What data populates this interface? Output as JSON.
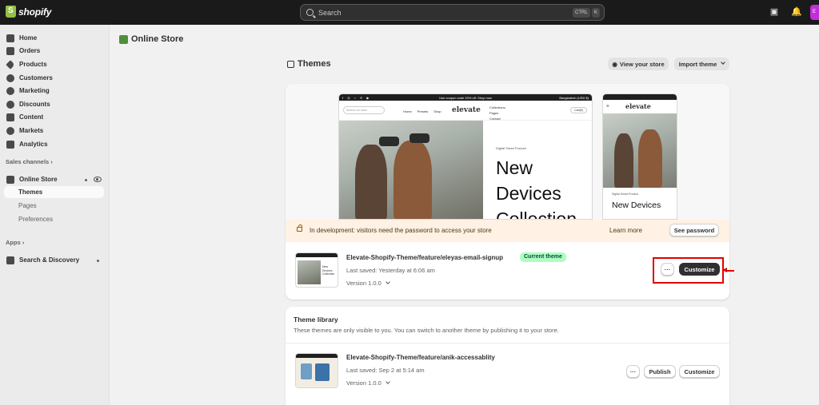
{
  "topbar": {
    "brand": "shopify",
    "search_placeholder": "Search",
    "shortcut_ctrl": "CTRL",
    "shortcut_key": "K",
    "avatar_initials": "E"
  },
  "sidebar": {
    "items": [
      {
        "label": "Home",
        "icon": "home-icon"
      },
      {
        "label": "Orders",
        "icon": "orders-icon"
      },
      {
        "label": "Products",
        "icon": "tag-icon"
      },
      {
        "label": "Customers",
        "icon": "person-icon"
      },
      {
        "label": "Marketing",
        "icon": "target-icon"
      },
      {
        "label": "Discounts",
        "icon": "discount-icon"
      },
      {
        "label": "Content",
        "icon": "content-icon"
      },
      {
        "label": "Markets",
        "icon": "globe-icon"
      },
      {
        "label": "Analytics",
        "icon": "bar-chart-icon"
      }
    ],
    "sales_channels_label": "Sales channels",
    "online_store_label": "Online Store",
    "sub_items": [
      "Themes",
      "Pages",
      "Preferences"
    ],
    "apps_label": "Apps",
    "search_discovery_label": "Search & Discovery"
  },
  "page": {
    "title": "Online Store",
    "themes_title": "Themes",
    "view_store_label": "View your store",
    "import_theme_label": "Import theme"
  },
  "preview": {
    "announcement": "Use coupon code 20% off. Shop now",
    "region": "Bangladesh (USD $)",
    "search_placeholder": "Search our store",
    "nav_links": [
      "Home",
      "Presets",
      "Shop"
    ],
    "logo": "elevate",
    "nav_links_right": [
      "Collections",
      "Pages",
      "Contact"
    ],
    "cart_label": "Cart(0)",
    "eyebrow": "Digital Smart Product",
    "headline_lines": [
      "New",
      "Devices",
      "Collection"
    ],
    "mobile_headline": "New Devices"
  },
  "banner": {
    "text": "In development: visitors need the password to access your store",
    "learn_more": "Learn more",
    "see_password": "See password"
  },
  "current_theme": {
    "name": "Elevate-Shopify-Theme/feature/eleyas-email-signup",
    "badge": "Current theme",
    "last_saved": "Last saved: Yesterday at 6:06 am",
    "version": "Version 1.0.0",
    "more_label": "···",
    "customize_label": "Customize",
    "thumb_text": "New Devices Collection"
  },
  "library": {
    "title": "Theme library",
    "description": "These themes are only visible to you. You can switch to another theme by publishing it to your store.",
    "themes": [
      {
        "name": "Elevate-Shopify-Theme/feature/anik-accessablity",
        "last_saved": "Last saved: Sep 2 at 5:14 am",
        "version": "Version 1.0.0",
        "more_label": "···",
        "publish_label": "Publish",
        "customize_label": "Customize"
      }
    ]
  },
  "colors": {
    "topbar": "#1a1a1a",
    "badge_bg": "#affebf",
    "banner_bg": "#fff1e3",
    "highlight": "#e00000"
  }
}
